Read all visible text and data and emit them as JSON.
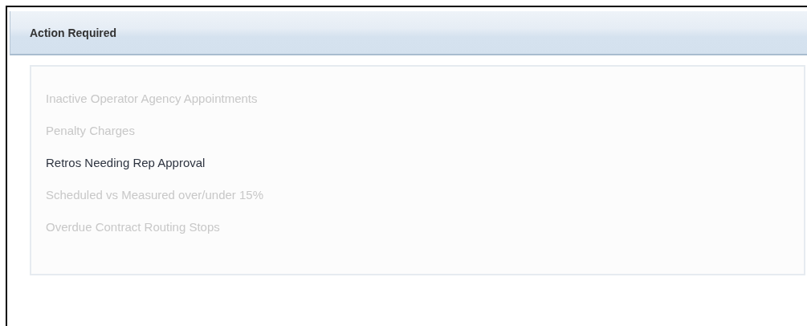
{
  "panel": {
    "title": "Action Required"
  },
  "items": [
    {
      "label": "Inactive Operator Agency Appointments",
      "disabled": true
    },
    {
      "label": "Penalty Charges",
      "disabled": true
    },
    {
      "label": "Retros Needing Rep Approval",
      "disabled": false
    },
    {
      "label": "Scheduled vs Measured over/under 15%",
      "disabled": true
    },
    {
      "label": "Overdue Contract Routing Stops",
      "disabled": true
    }
  ]
}
